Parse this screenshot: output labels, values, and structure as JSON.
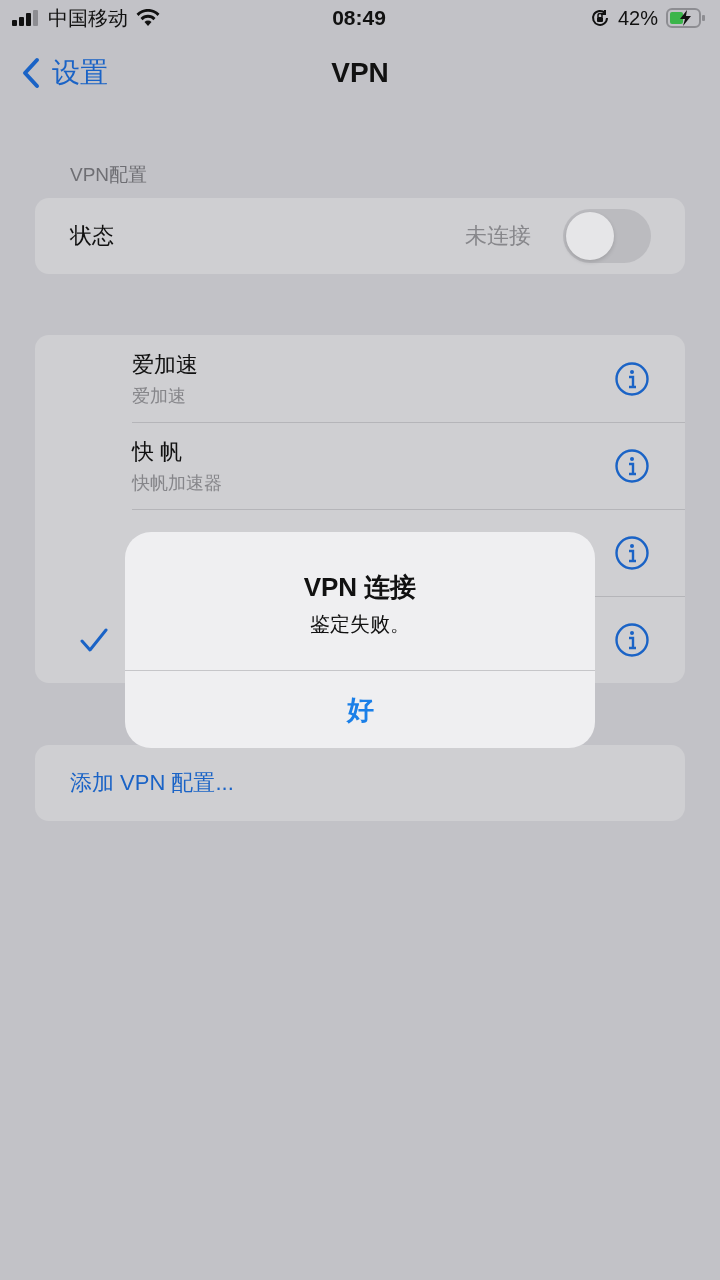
{
  "status_bar": {
    "carrier": "中国移动",
    "time": "08:49",
    "battery_percent": "42%"
  },
  "nav": {
    "back_label": "设置",
    "title": "VPN"
  },
  "vpn_section": {
    "header": "VPN配置",
    "status_label": "状态",
    "status_value": "未连接",
    "on": false
  },
  "configs": [
    {
      "title": "爱加速",
      "subtitle": "爱加速",
      "selected": false
    },
    {
      "title": "快 帆",
      "subtitle": "快帆加速器",
      "selected": false
    },
    {
      "selected": false
    },
    {
      "selected": true
    }
  ],
  "add_config": "添加 VPN 配置...",
  "alert": {
    "title": "VPN 连接",
    "message": "鉴定失败。",
    "button": "好"
  }
}
